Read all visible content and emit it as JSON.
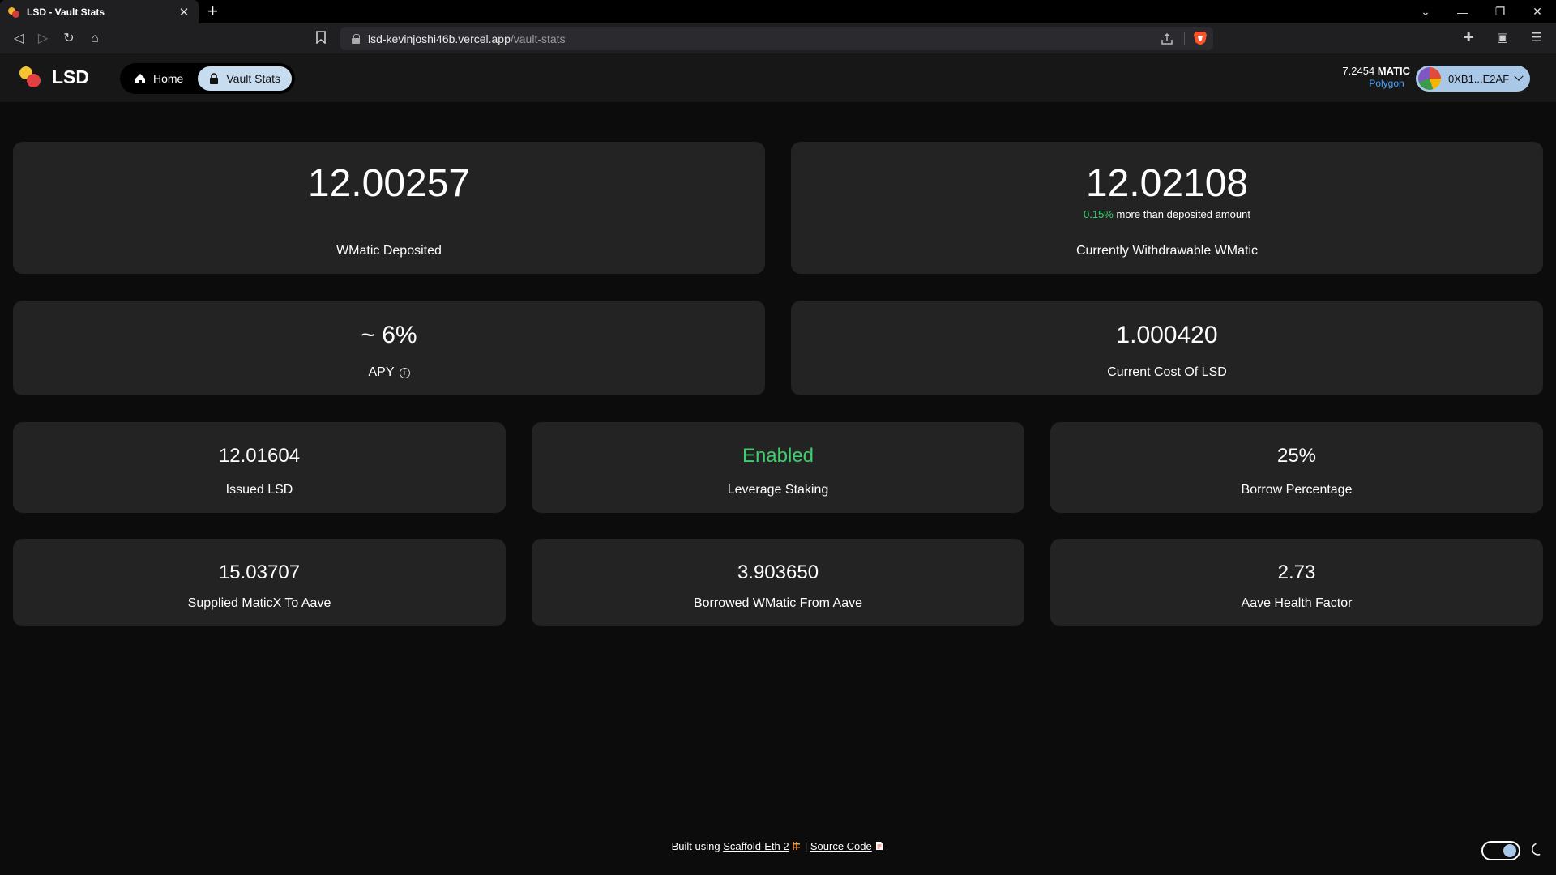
{
  "browser": {
    "tab_title": "LSD - Vault Stats",
    "url_host": "lsd-kevinjoshi46b.vercel.app",
    "url_path": "/vault-stats"
  },
  "header": {
    "logo_text": "LSD",
    "nav": [
      {
        "label": "Home",
        "icon": "home-icon",
        "active": false
      },
      {
        "label": "Vault Stats",
        "icon": "lock-icon",
        "active": true
      }
    ],
    "balance": "7.2454",
    "balance_unit": "MATIC",
    "network": "Polygon",
    "wallet_address": "0XB1...E2AF"
  },
  "stats": {
    "wmatic_deposited": {
      "value": "12.00257",
      "label": "WMatic Deposited"
    },
    "withdrawable": {
      "value": "12.02108",
      "pct": "0.15%",
      "note": " more than deposited amount",
      "label": "Currently Withdrawable WMatic"
    },
    "apy": {
      "value": "~ 6%",
      "label": "APY"
    },
    "cost_of_lsd": {
      "value": "1.000420",
      "label": "Current Cost Of LSD"
    },
    "issued_lsd": {
      "value": "12.01604",
      "label": "Issued LSD"
    },
    "leverage_staking": {
      "value": "Enabled",
      "label": "Leverage Staking"
    },
    "borrow_percentage": {
      "value": "25%",
      "label": "Borrow Percentage"
    },
    "supplied_maticx": {
      "value": "15.03707",
      "label": "Supplied MaticX To Aave"
    },
    "borrowed_wmatic": {
      "value": "3.903650",
      "label": "Borrowed WMatic From Aave"
    },
    "health_factor": {
      "value": "2.73",
      "label": "Aave Health Factor"
    }
  },
  "footer": {
    "built_using": "Built using ",
    "scaffold_link": "Scaffold-Eth 2",
    "separator": " | ",
    "source_link": "Source Code"
  },
  "colors": {
    "accent_green": "#3ecf6a",
    "active_pill": "#c8dcf0",
    "network_blue": "#4aa3ff"
  }
}
